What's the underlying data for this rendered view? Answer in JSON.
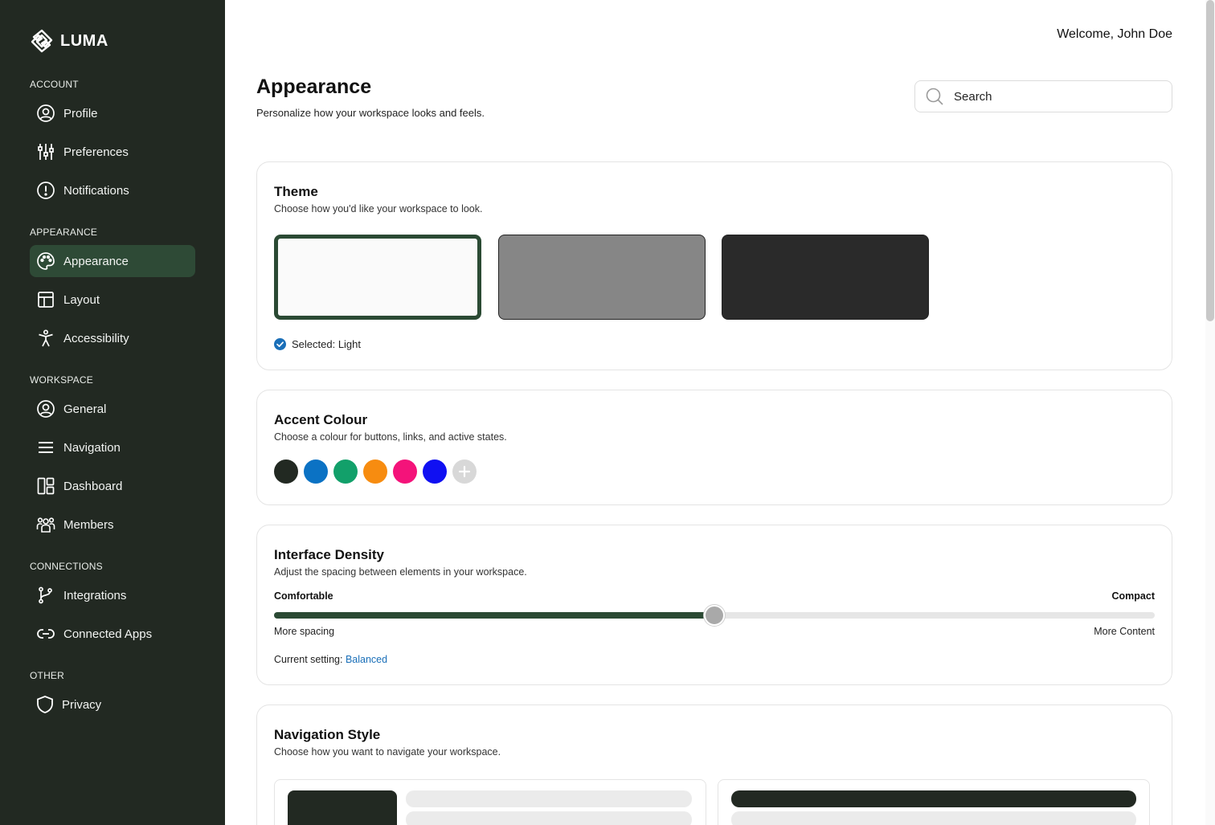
{
  "app": {
    "name": "LUMA"
  },
  "header": {
    "welcome": "Welcome, John Doe",
    "search_placeholder": "Search"
  },
  "page": {
    "title": "Appearance",
    "subtitle": "Personalize how your workspace looks and feels."
  },
  "sidebar": {
    "sections": [
      {
        "label": "ACCOUNT",
        "items": [
          {
            "label": "Profile",
            "icon": "user-circle-icon"
          },
          {
            "label": "Preferences",
            "icon": "sliders-icon"
          },
          {
            "label": "Notifications",
            "icon": "alert-circle-icon"
          }
        ]
      },
      {
        "label": "APPEARANCE",
        "items": [
          {
            "label": "Appearance",
            "icon": "palette-icon",
            "active": true
          },
          {
            "label": "Layout",
            "icon": "layout-icon"
          },
          {
            "label": "Accessibility",
            "icon": "accessibility-icon"
          }
        ]
      },
      {
        "label": "WORKSPACE",
        "items": [
          {
            "label": "General",
            "icon": "user-circle-icon"
          },
          {
            "label": "Navigation",
            "icon": "menu-icon"
          },
          {
            "label": "Dashboard",
            "icon": "dashboard-icon"
          },
          {
            "label": "Members",
            "icon": "users-icon"
          }
        ]
      },
      {
        "label": "CONNECTIONS",
        "items": [
          {
            "label": "Integrations",
            "icon": "git-branch-icon"
          },
          {
            "label": "Connected Apps",
            "icon": "link-icon"
          }
        ]
      },
      {
        "label": "OTHER",
        "items": [
          {
            "label": "Privacy",
            "icon": "shield-icon"
          }
        ]
      }
    ]
  },
  "theme": {
    "title": "Theme",
    "subtitle": "Choose how you'd like your workspace to look.",
    "options": [
      {
        "fill": "#fafafa",
        "border": "#2b4a34",
        "selected": true
      },
      {
        "fill": "#868686",
        "border": "#222222",
        "selected": false
      },
      {
        "fill": "#2a2a2a",
        "border": "#222222",
        "selected": false
      }
    ],
    "selected_label": "Selected: Light",
    "check_color": "#1a6fb8"
  },
  "accent": {
    "title": "Accent Colour",
    "subtitle": "Choose a colour for buttons, links, and active states.",
    "colors": [
      "#222922",
      "#0b72c4",
      "#12a06a",
      "#f78c10",
      "#f4137a",
      "#1010f2"
    ]
  },
  "density": {
    "title": "Interface Density",
    "subtitle": "Adjust the spacing between elements in your workspace.",
    "left_label": "Comfortable",
    "right_label": "Compact",
    "left_hint": "More spacing",
    "right_hint": "More Content",
    "value": 0.5,
    "current_prefix": "Current setting:",
    "current_value": "Balanced"
  },
  "navigation_style": {
    "title": "Navigation Style",
    "subtitle": "Choose how you want to navigate your workspace."
  }
}
